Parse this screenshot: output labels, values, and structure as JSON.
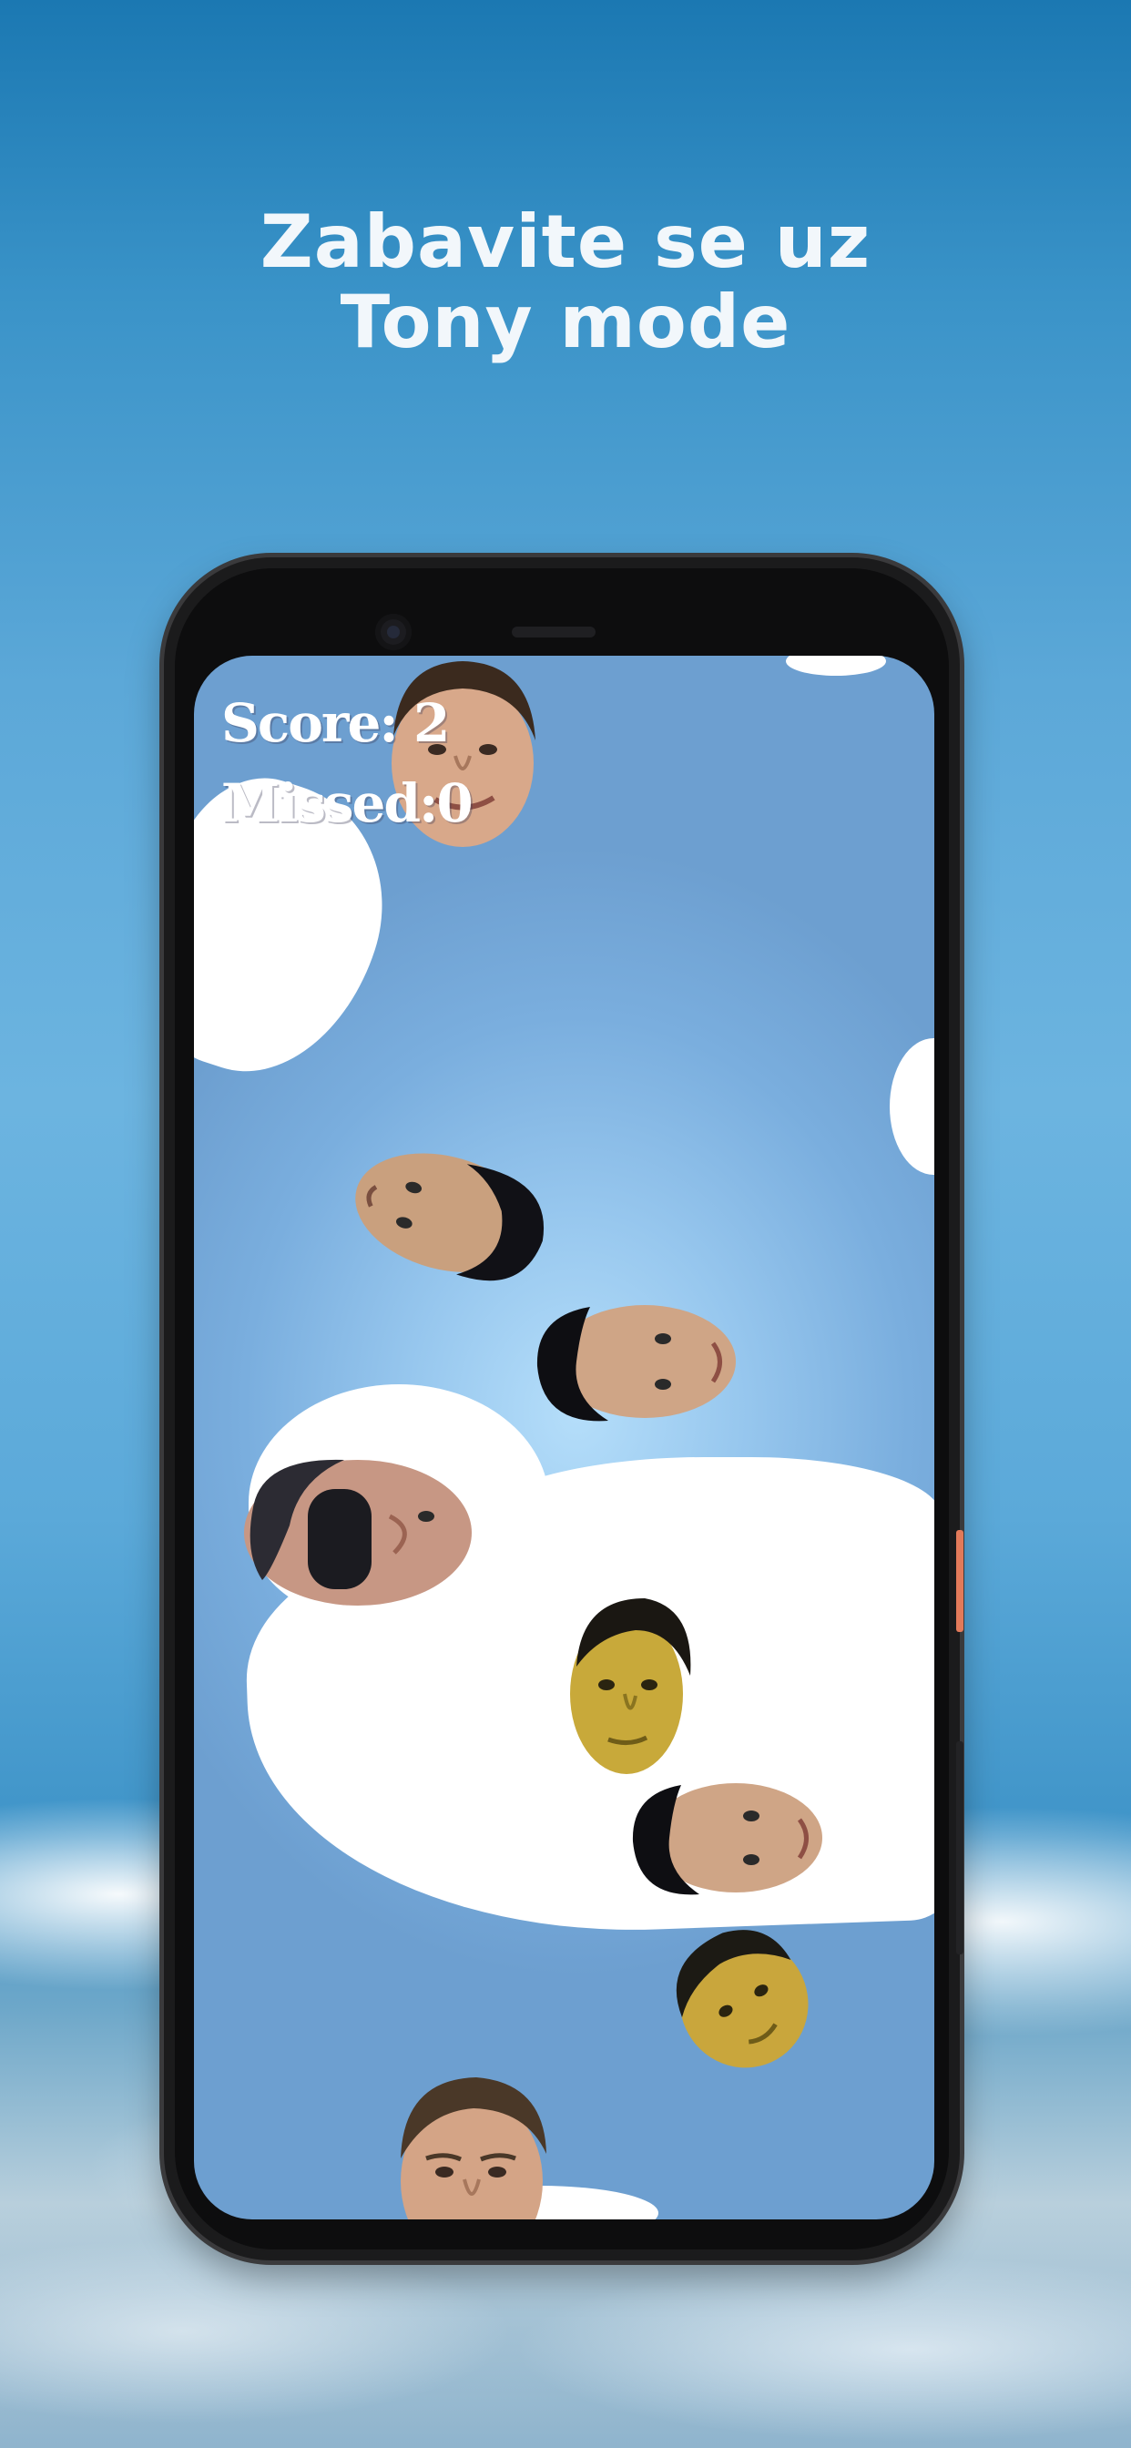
{
  "headline": {
    "line1": "Zabavite se uz",
    "line2": "Tony mode"
  },
  "game": {
    "score_label": "Score:",
    "score_value": "2",
    "missed_label": "Missed:",
    "missed_value": "0"
  },
  "colors": {
    "sky_top": "#1b78b2",
    "sky_mid": "#6cb4e0",
    "screen_center": "#b5defa",
    "screen_edge": "#6d9fd0",
    "phone_body": "#1b1b1c",
    "side_button_accent": "#e27a5a",
    "hud_text": "#ffffff"
  },
  "targets": [
    {
      "name": "face-smiling-boy",
      "skin": "#d8a88a",
      "hair": "#3b2a1e"
    },
    {
      "name": "face-tilted-dark-hair",
      "skin": "#c9a07e",
      "hair": "#111116"
    },
    {
      "name": "face-tilted-right",
      "skin": "#cfa586",
      "hair": "#0e0e12"
    },
    {
      "name": "face-sunglasses",
      "skin": "#c79784",
      "hair": "#2c2b33"
    },
    {
      "name": "face-yellow-tint",
      "skin": "#c8a93a",
      "hair": "#1a1712"
    },
    {
      "name": "face-tilted-right-lower",
      "skin": "#cfa586",
      "hair": "#0e0e12"
    },
    {
      "name": "face-yellow-tilted",
      "skin": "#c9a63c",
      "hair": "#1c1a14"
    },
    {
      "name": "face-bottom-boy",
      "skin": "#d4a486",
      "hair": "#4a3828"
    }
  ]
}
